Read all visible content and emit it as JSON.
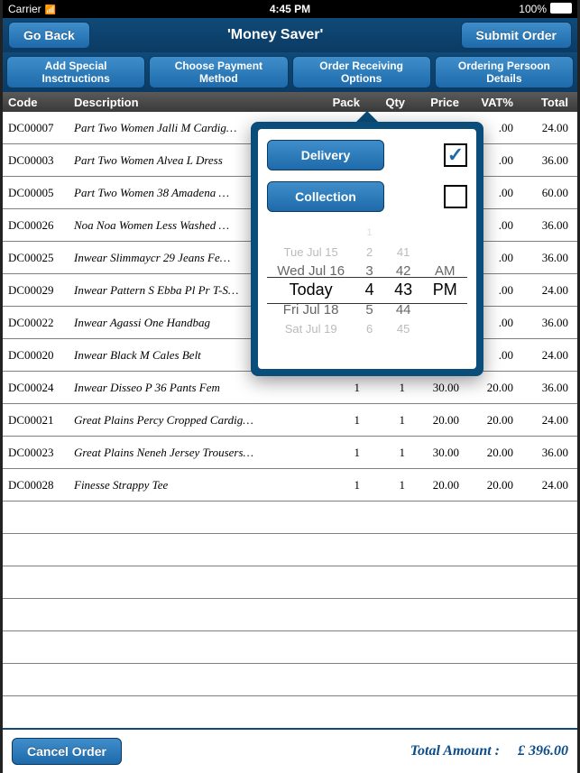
{
  "status": {
    "carrier": "Carrier",
    "time": "4:45 PM",
    "battery": "100%"
  },
  "topbar": {
    "back": "Go Back",
    "title": "'Money Saver'",
    "submit": "Submit Order"
  },
  "subbar": {
    "instructions": "Add  Special\nInsctructions",
    "payment": "Choose  Payment\nMethod",
    "receiving": "Order  Receiving\nOptions",
    "person": "Ordering  Persoon\nDetails"
  },
  "headers": {
    "code": "Code",
    "desc": "Description",
    "pack": "Pack",
    "qty": "Qty",
    "price": "Price",
    "vat": "VAT%",
    "total": "Total"
  },
  "rows": [
    {
      "code": "DC00007",
      "desc": "Part Two Women Jalli M Cardig…",
      "pack": "",
      "qty": "",
      "price": "",
      "vat": ".00",
      "total": "24.00"
    },
    {
      "code": "DC00003",
      "desc": "Part Two Women Alvea L Dress",
      "pack": "",
      "qty": "",
      "price": "",
      "vat": ".00",
      "total": "36.00"
    },
    {
      "code": "DC00005",
      "desc": "Part Two Women 38 Amadena …",
      "pack": "",
      "qty": "",
      "price": "",
      "vat": ".00",
      "total": "60.00"
    },
    {
      "code": "DC00026",
      "desc": "Noa Noa Women Less Washed …",
      "pack": "",
      "qty": "",
      "price": "",
      "vat": ".00",
      "total": "36.00"
    },
    {
      "code": "DC00025",
      "desc": "Inwear Slimmaycr 29 Jeans Fe…",
      "pack": "",
      "qty": "",
      "price": "",
      "vat": ".00",
      "total": "36.00"
    },
    {
      "code": "DC00029",
      "desc": "Inwear Pattern S Ebba Pl Pr T-S…",
      "pack": "",
      "qty": "",
      "price": "",
      "vat": ".00",
      "total": "24.00"
    },
    {
      "code": "DC00022",
      "desc": "Inwear Agassi One Handbag",
      "pack": "",
      "qty": "",
      "price": "",
      "vat": ".00",
      "total": "36.00"
    },
    {
      "code": "DC00020",
      "desc": "Inwear Black M Cales Belt",
      "pack": "",
      "qty": "",
      "price": "",
      "vat": ".00",
      "total": "24.00"
    },
    {
      "code": "DC00024",
      "desc": "Inwear Disseo P 36 Pants Fem",
      "pack": "1",
      "qty": "1",
      "price": "30.00",
      "vat": "20.00",
      "total": "36.00"
    },
    {
      "code": "DC00021",
      "desc": "Great Plains Percy Cropped Cardig…",
      "pack": "1",
      "qty": "1",
      "price": "20.00",
      "vat": "20.00",
      "total": "24.00"
    },
    {
      "code": "DC00023",
      "desc": "Great Plains Neneh Jersey Trousers…",
      "pack": "1",
      "qty": "1",
      "price": "30.00",
      "vat": "20.00",
      "total": "36.00"
    },
    {
      "code": "DC00028",
      "desc": "Finesse Strappy Tee",
      "pack": "1",
      "qty": "1",
      "price": "20.00",
      "vat": "20.00",
      "total": "24.00"
    }
  ],
  "footer": {
    "cancel": "Cancel Order",
    "total_label": "Total Amount :",
    "total_value": "£ 396.00"
  },
  "popover": {
    "delivery": "Delivery",
    "collection": "Collection",
    "delivery_checked": true,
    "collection_checked": false,
    "picker": {
      "dates": [
        "",
        "Tue Jul 15",
        "Wed Jul 16",
        "Today",
        "Fri Jul 18",
        "Sat Jul 19",
        ""
      ],
      "hours": [
        "1",
        "2",
        "3",
        "4",
        "5",
        "6",
        ""
      ],
      "minutes": [
        "",
        "41",
        "42",
        "43",
        "44",
        "45",
        ""
      ],
      "ampm": [
        "",
        "",
        "AM",
        "PM",
        "",
        "",
        ""
      ]
    }
  }
}
